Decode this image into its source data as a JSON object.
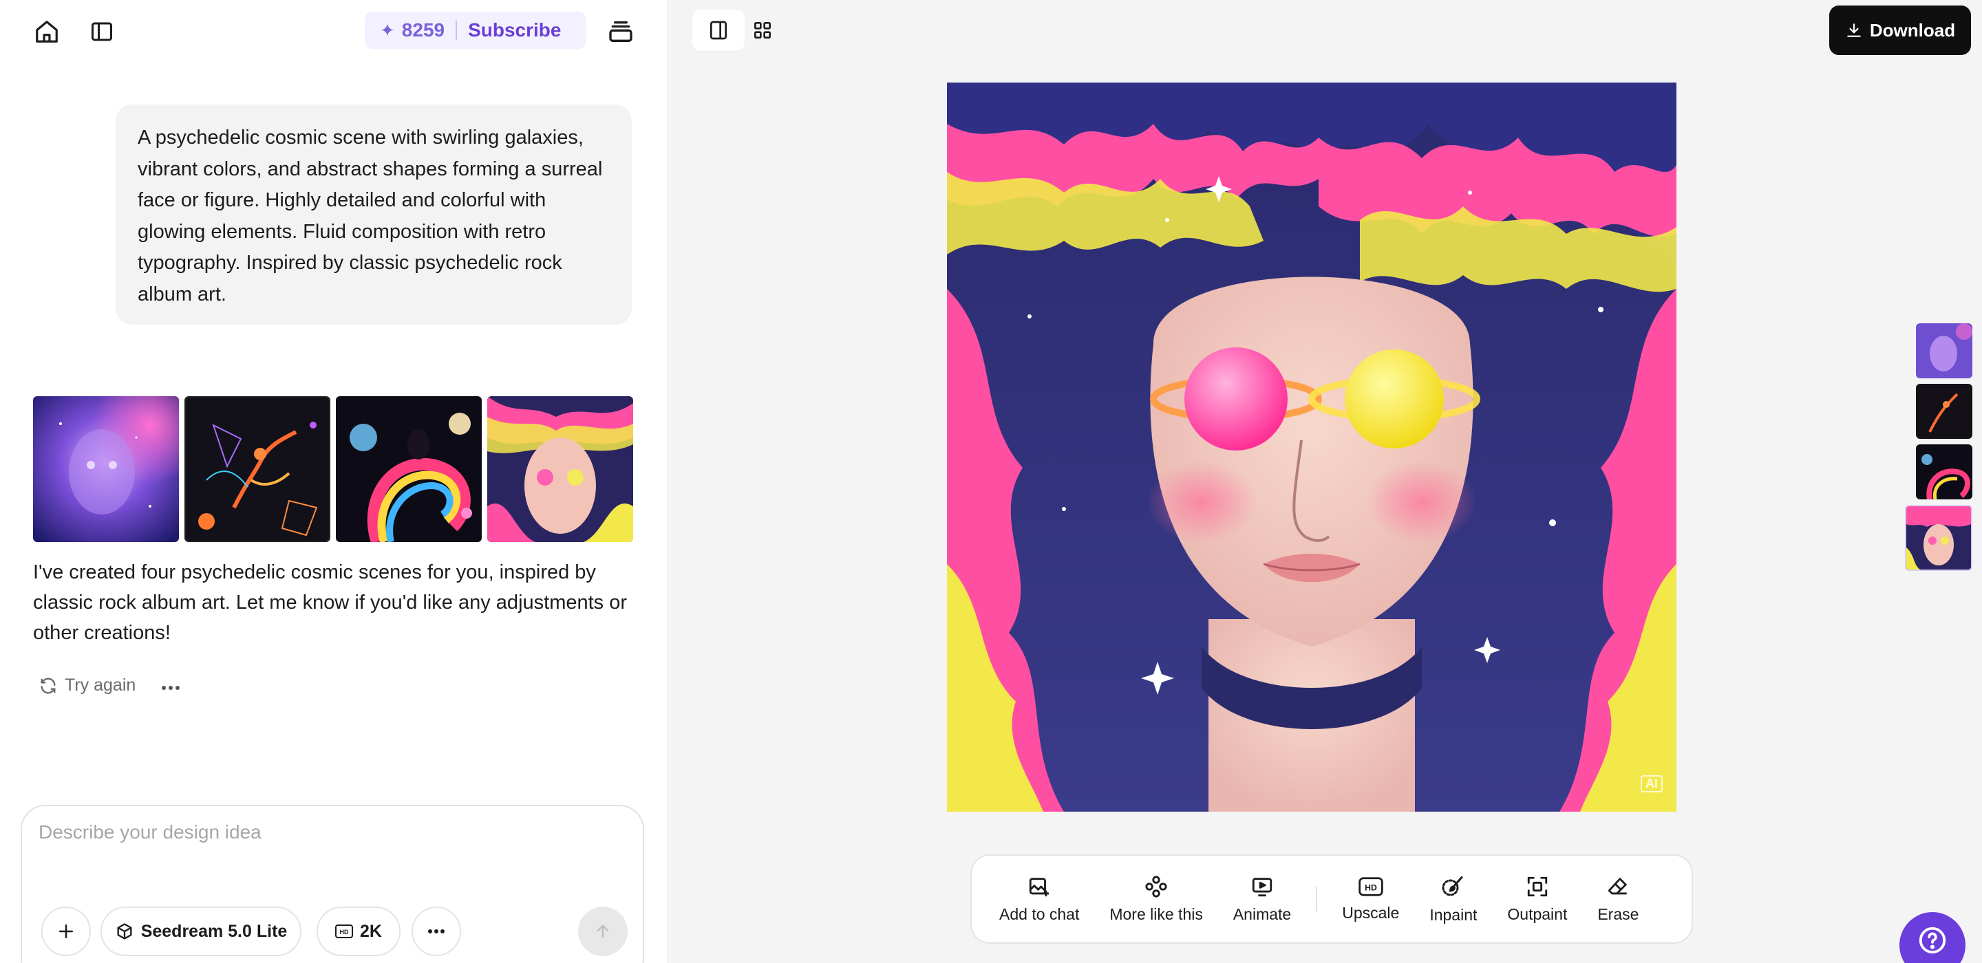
{
  "credits": {
    "count": "8259",
    "subscribe_label": "Subscribe"
  },
  "chat": {
    "prompt": "A psychedelic cosmic scene with swirling galaxies, vibrant colors, and abstract shapes forming a surreal face or figure. Highly detailed and colorful with glowing elements. Fluid composition with retro typography. Inspired by classic psychedelic rock album art.",
    "response": "I've created four psychedelic cosmic scenes for you, inspired by classic rock album art. Let me know if you'd like any adjustments or other creations!",
    "try_again_label": "Try again"
  },
  "composer": {
    "placeholder": "Describe your design idea",
    "model_label": "Seedream 5.0 Lite",
    "resolution_label": "2K"
  },
  "viewer": {
    "download_label": "Download",
    "ai_badge": "AI"
  },
  "toolbar": {
    "tools": [
      {
        "label": "Add to chat",
        "icon": "image-add-icon"
      },
      {
        "label": "More like this",
        "icon": "variations-icon"
      },
      {
        "label": "Animate",
        "icon": "animate-icon"
      },
      {
        "label": "Upscale",
        "icon": "hd-icon"
      },
      {
        "label": "Inpaint",
        "icon": "brush-icon"
      },
      {
        "label": "Outpaint",
        "icon": "expand-icon"
      },
      {
        "label": "Erase",
        "icon": "eraser-icon"
      }
    ]
  },
  "colors": {
    "accent": "#6a3ddc",
    "credits_bg": "#f3f0ff",
    "download_bg": "#0f0f0f"
  }
}
